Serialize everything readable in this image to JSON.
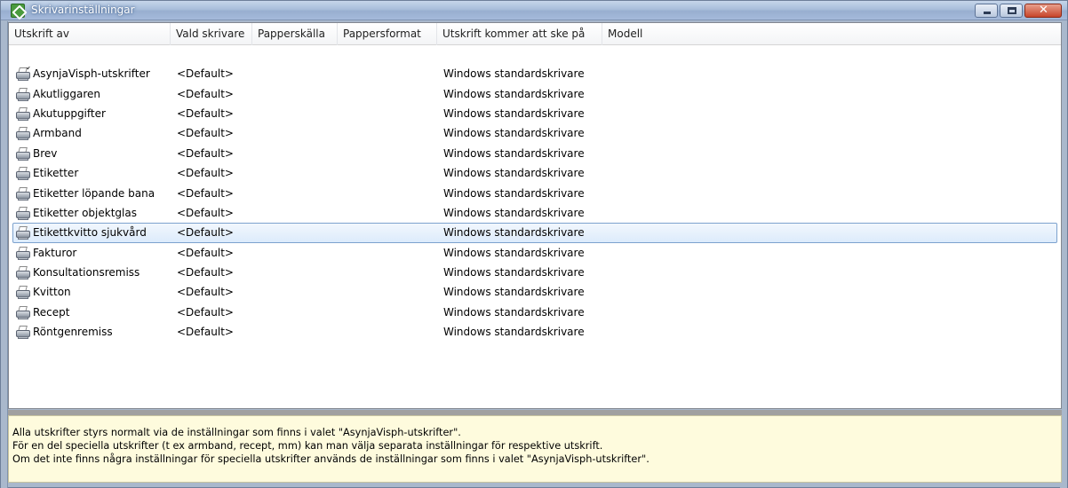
{
  "window": {
    "title": "Skrivarinställningar"
  },
  "columns": [
    "Utskrift av",
    "Vald skrivare",
    "Papperskälla",
    "Pappersformat",
    "Utskrift kommer att ske på",
    "Modell"
  ],
  "rows": [
    {
      "name": "AsynjaVisph-utskrifter",
      "printer": "<Default>",
      "source": "",
      "format": "",
      "target": "Windows standardskrivare",
      "model": "",
      "icon": "printer-default-icon"
    },
    {
      "name": "Akutliggaren",
      "printer": "<Default>",
      "source": "",
      "format": "",
      "target": "Windows standardskrivare",
      "model": "",
      "icon": "printer-icon"
    },
    {
      "name": "Akutuppgifter",
      "printer": "<Default>",
      "source": "",
      "format": "",
      "target": "Windows standardskrivare",
      "model": "",
      "icon": "printer-icon"
    },
    {
      "name": "Armband",
      "printer": "<Default>",
      "source": "",
      "format": "",
      "target": "Windows standardskrivare",
      "model": "",
      "icon": "printer-icon"
    },
    {
      "name": "Brev",
      "printer": "<Default>",
      "source": "",
      "format": "",
      "target": "Windows standardskrivare",
      "model": "",
      "icon": "printer-icon"
    },
    {
      "name": "Etiketter",
      "printer": "<Default>",
      "source": "",
      "format": "",
      "target": "Windows standardskrivare",
      "model": "",
      "icon": "printer-icon"
    },
    {
      "name": "Etiketter löpande bana",
      "printer": "<Default>",
      "source": "",
      "format": "",
      "target": "Windows standardskrivare",
      "model": "",
      "icon": "printer-icon"
    },
    {
      "name": "Etiketter objektglas",
      "printer": "<Default>",
      "source": "",
      "format": "",
      "target": "Windows standardskrivare",
      "model": "",
      "icon": "printer-icon"
    },
    {
      "name": "Etikettkvitto sjukvård",
      "printer": "<Default>",
      "source": "",
      "format": "",
      "target": "Windows standardskrivare",
      "model": "",
      "icon": "printer-icon",
      "selected": true
    },
    {
      "name": "Fakturor",
      "printer": "<Default>",
      "source": "",
      "format": "",
      "target": "Windows standardskrivare",
      "model": "",
      "icon": "printer-icon"
    },
    {
      "name": "Konsultationsremiss",
      "printer": "<Default>",
      "source": "",
      "format": "",
      "target": "Windows standardskrivare",
      "model": "",
      "icon": "printer-icon"
    },
    {
      "name": "Kvitton",
      "printer": "<Default>",
      "source": "",
      "format": "",
      "target": "Windows standardskrivare",
      "model": "",
      "icon": "printer-icon"
    },
    {
      "name": "Recept",
      "printer": "<Default>",
      "source": "",
      "format": "",
      "target": "Windows standardskrivare",
      "model": "",
      "icon": "printer-icon"
    },
    {
      "name": "Röntgenremiss",
      "printer": "<Default>",
      "source": "",
      "format": "",
      "target": "Windows standardskrivare",
      "model": "",
      "icon": "printer-icon"
    }
  ],
  "info": {
    "lines": [
      "Alla utskrifter styrs normalt via de inställningar som finns i valet \"AsynjaVisph-utskrifter\".",
      "För en del speciella utskrifter (t ex armband, recept, mm) kan man välja separata inställningar för respektive utskrift.",
      "Om det inte finns några inställningar för speciella utskrifter används de inställningar som finns i valet \"AsynjaVisph-utskrifter\"."
    ]
  },
  "colors": {
    "titlebar": "#a9bedb",
    "selection_border": "#7da2ce",
    "info_background": "#fefbdd"
  }
}
